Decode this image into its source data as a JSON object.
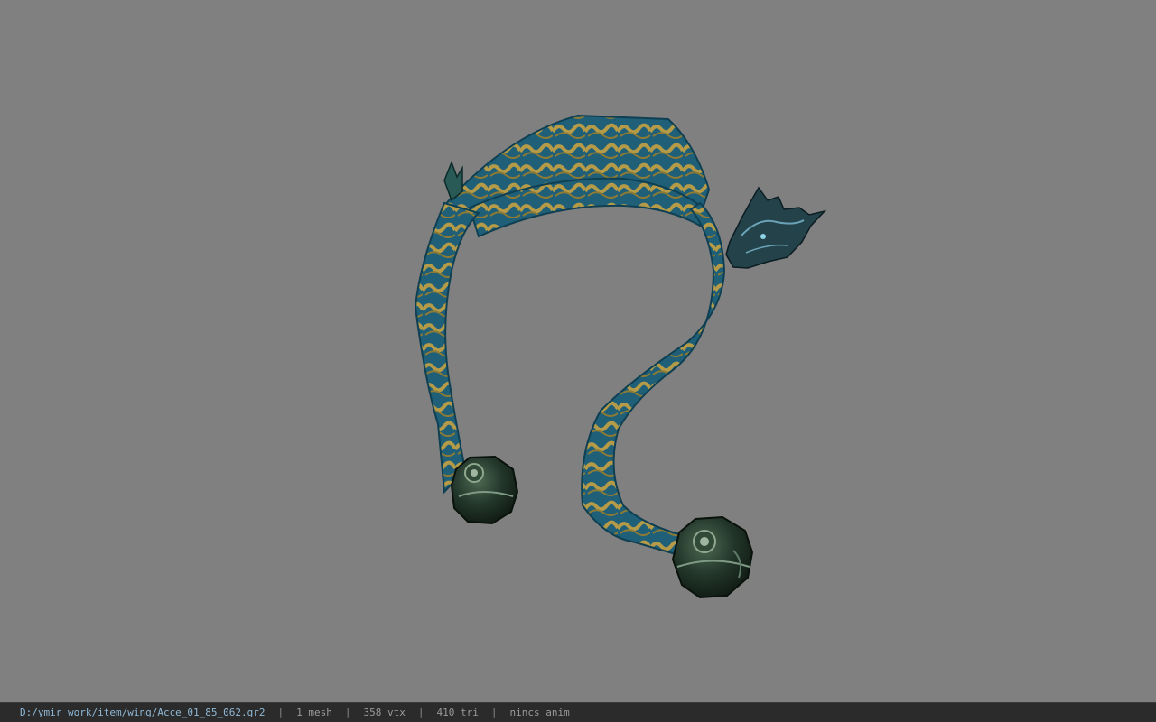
{
  "viewport": {
    "background_color": "#808080",
    "model_name": "Acce_01_85_062.gr2"
  },
  "status_bar": {
    "file_path": "D:/ymir work/item/wing/Acce_01_85_062.gr2",
    "separator": "|",
    "mesh_count": "1 mesh",
    "vertex_count": "358 vtx",
    "triangle_count": "410 tri",
    "animation": "nincs anim"
  },
  "colors": {
    "ribbon_teal": "#1f5f78",
    "ribbon_gold": "#a89040",
    "bell_dark": "#1c2a1e"
  }
}
